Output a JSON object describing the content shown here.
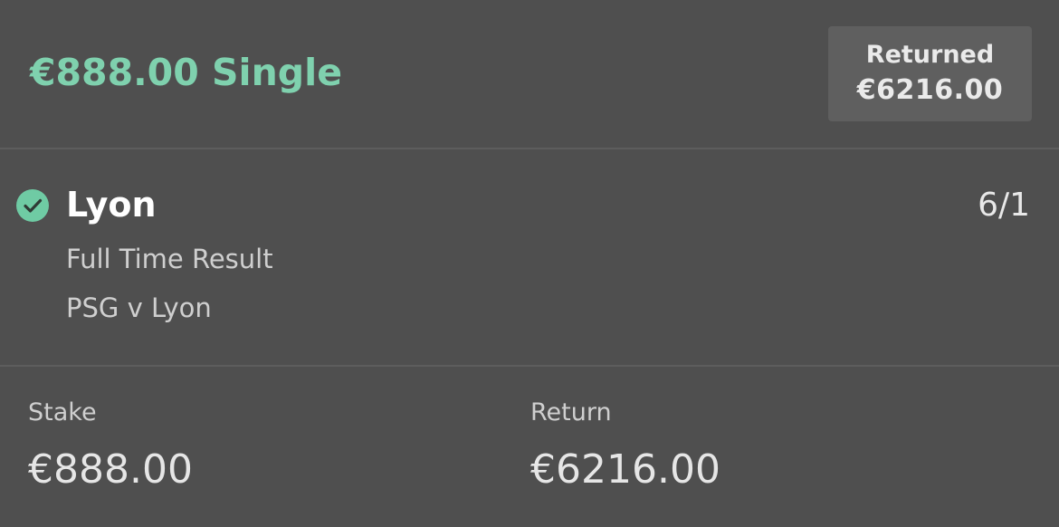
{
  "bet": {
    "title": "€888.00 Single",
    "status_label": "Returned",
    "status_value": "€6216.00"
  },
  "selection": {
    "name": "Lyon",
    "odds": "6/1",
    "market": "Full Time Result",
    "event": "PSG v Lyon",
    "result_icon": "check-circle-icon"
  },
  "summary": {
    "stake_label": "Stake",
    "stake_value": "€888.00",
    "return_label": "Return",
    "return_value": "€6216.00"
  },
  "colors": {
    "accent": "#7fd1ae",
    "background": "#4f4f4f"
  }
}
